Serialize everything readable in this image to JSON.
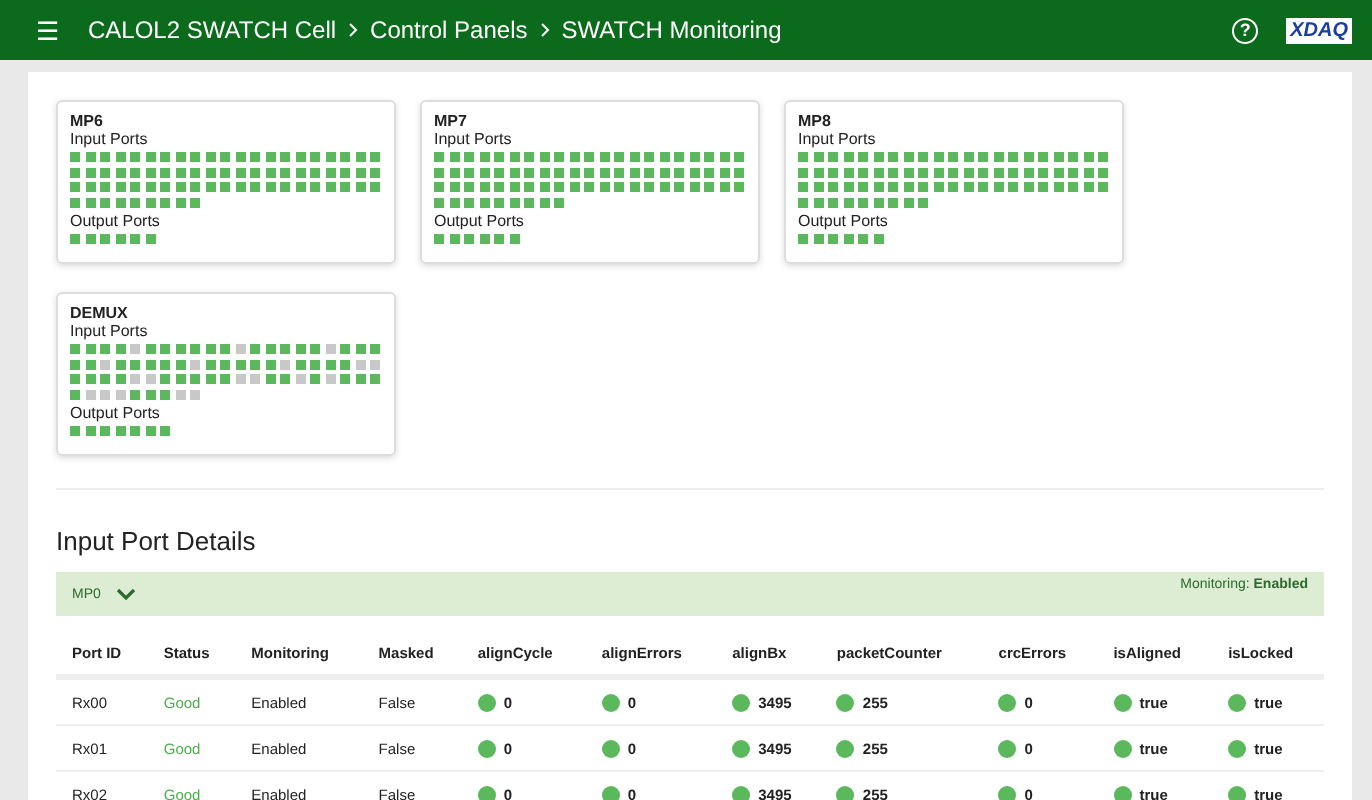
{
  "header": {
    "menu_icon": "☰",
    "breadcrumbs": [
      "CALOL2 SWATCH Cell",
      "Control Panels",
      "SWATCH Monitoring"
    ],
    "help_icon": "?",
    "logo": "XDAQ"
  },
  "boards": [
    {
      "name": "MP6",
      "input_label": "Input Ports",
      "output_label": "Output Ports",
      "input_ports": [
        true,
        true,
        true,
        true,
        true,
        true,
        true,
        true,
        true,
        true,
        true,
        true,
        true,
        true,
        true,
        true,
        true,
        true,
        true,
        true,
        true,
        true,
        true,
        true,
        true,
        true,
        true,
        true,
        true,
        true,
        true,
        true,
        true,
        true,
        true,
        true,
        true,
        true,
        true,
        true,
        true,
        true,
        true,
        true,
        true,
        true,
        true,
        true,
        true,
        true,
        true,
        true,
        true,
        true,
        true,
        true,
        true,
        true,
        true,
        true,
        true,
        true,
        true,
        true,
        true,
        true,
        true,
        true,
        true,
        true,
        true,
        true
      ],
      "output_ports": [
        true,
        true,
        true,
        true,
        true,
        true
      ]
    },
    {
      "name": "MP7",
      "input_label": "Input Ports",
      "output_label": "Output Ports",
      "input_ports": [
        true,
        true,
        true,
        true,
        true,
        true,
        true,
        true,
        true,
        true,
        true,
        true,
        true,
        true,
        true,
        true,
        true,
        true,
        true,
        true,
        true,
        true,
        true,
        true,
        true,
        true,
        true,
        true,
        true,
        true,
        true,
        true,
        true,
        true,
        true,
        true,
        true,
        true,
        true,
        true,
        true,
        true,
        true,
        true,
        true,
        true,
        true,
        true,
        true,
        true,
        true,
        true,
        true,
        true,
        true,
        true,
        true,
        true,
        true,
        true,
        true,
        true,
        true,
        true,
        true,
        true,
        true,
        true,
        true,
        true,
        true,
        true
      ],
      "output_ports": [
        true,
        true,
        true,
        true,
        true,
        true
      ]
    },
    {
      "name": "MP8",
      "input_label": "Input Ports",
      "output_label": "Output Ports",
      "input_ports": [
        true,
        true,
        true,
        true,
        true,
        true,
        true,
        true,
        true,
        true,
        true,
        true,
        true,
        true,
        true,
        true,
        true,
        true,
        true,
        true,
        true,
        true,
        true,
        true,
        true,
        true,
        true,
        true,
        true,
        true,
        true,
        true,
        true,
        true,
        true,
        true,
        true,
        true,
        true,
        true,
        true,
        true,
        true,
        true,
        true,
        true,
        true,
        true,
        true,
        true,
        true,
        true,
        true,
        true,
        true,
        true,
        true,
        true,
        true,
        true,
        true,
        true,
        true,
        true,
        true,
        true,
        true,
        true,
        true,
        true,
        true,
        true
      ],
      "output_ports": [
        true,
        true,
        true,
        true,
        true,
        true
      ]
    },
    {
      "name": "DEMUX",
      "input_label": "Input Ports",
      "output_label": "Output Ports",
      "input_ports": [
        true,
        true,
        true,
        true,
        false,
        true,
        true,
        true,
        true,
        true,
        true,
        false,
        true,
        true,
        true,
        true,
        true,
        false,
        true,
        true,
        true,
        true,
        true,
        false,
        true,
        true,
        true,
        true,
        true,
        false,
        true,
        true,
        true,
        true,
        true,
        false,
        true,
        true,
        true,
        true,
        false,
        false,
        true,
        true,
        true,
        true,
        false,
        false,
        true,
        true,
        true,
        true,
        true,
        false,
        false,
        true,
        true,
        false,
        true,
        false,
        true,
        true,
        true,
        true,
        false,
        false,
        false,
        true,
        true,
        true,
        false,
        false
      ],
      "output_ports": [
        true,
        true,
        true,
        true,
        true,
        true,
        true
      ]
    }
  ],
  "details": {
    "title": "Input Port Details",
    "section": {
      "name": "MP0",
      "expanded": true,
      "monitoring_label": "Monitoring:",
      "monitoring_value": "Enabled"
    },
    "columns": [
      "Port ID",
      "Status",
      "Monitoring",
      "Masked",
      "alignCycle",
      "alignErrors",
      "alignBx",
      "packetCounter",
      "crcErrors",
      "isAligned",
      "isLocked"
    ],
    "rows": [
      {
        "port_id": "Rx00",
        "status": "Good",
        "monitoring": "Enabled",
        "masked": "False",
        "metrics": [
          {
            "value": "0",
            "ok": true
          },
          {
            "value": "0",
            "ok": true
          },
          {
            "value": "3495",
            "ok": true
          },
          {
            "value": "255",
            "ok": true
          },
          {
            "value": "0",
            "ok": true
          },
          {
            "value": "true",
            "ok": true
          },
          {
            "value": "true",
            "ok": true
          }
        ]
      },
      {
        "port_id": "Rx01",
        "status": "Good",
        "monitoring": "Enabled",
        "masked": "False",
        "metrics": [
          {
            "value": "0",
            "ok": true
          },
          {
            "value": "0",
            "ok": true
          },
          {
            "value": "3495",
            "ok": true
          },
          {
            "value": "255",
            "ok": true
          },
          {
            "value": "0",
            "ok": true
          },
          {
            "value": "true",
            "ok": true
          },
          {
            "value": "true",
            "ok": true
          }
        ]
      },
      {
        "port_id": "Rx02",
        "status": "Good",
        "monitoring": "Enabled",
        "masked": "False",
        "metrics": [
          {
            "value": "0",
            "ok": true
          },
          {
            "value": "0",
            "ok": true
          },
          {
            "value": "3495",
            "ok": true
          },
          {
            "value": "255",
            "ok": true
          },
          {
            "value": "0",
            "ok": true
          },
          {
            "value": "true",
            "ok": true
          },
          {
            "value": "true",
            "ok": true
          }
        ]
      }
    ]
  }
}
